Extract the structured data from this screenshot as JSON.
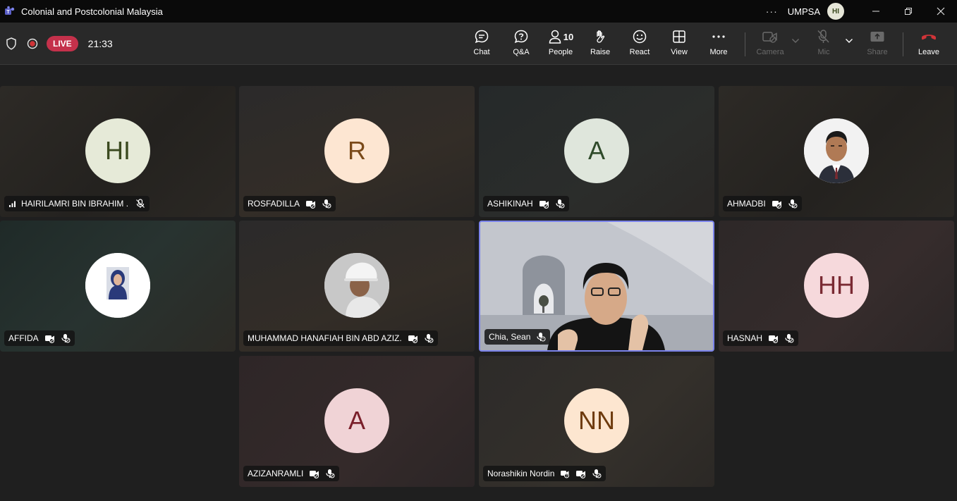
{
  "window": {
    "title": "Colonial and Postcolonial Malaysia",
    "more": "···",
    "org": "UMPSA",
    "user_initials": "HI"
  },
  "toolbar": {
    "live_label": "LIVE",
    "timer": "21:33",
    "chat": "Chat",
    "qa": "Q&A",
    "people": "People",
    "people_count": "10",
    "raise": "Raise",
    "react": "React",
    "view": "View",
    "more": "More",
    "camera": "Camera",
    "mic": "Mic",
    "share": "Share",
    "leave": "Leave"
  },
  "participants": [
    {
      "name": "HAIRILAMRI BIN IBRAHIM .",
      "initials": "HI",
      "avatar_bg": "#e6ead8",
      "avatar_fg": "#3b4a1f"
    },
    {
      "name": "ROSFADILLA",
      "initials": "R",
      "avatar_bg": "#fde6d2",
      "avatar_fg": "#7a4a1a"
    },
    {
      "name": "ASHIKINAH",
      "initials": "A",
      "avatar_bg": "#dfe6dc",
      "avatar_fg": "#2f4a2a"
    },
    {
      "name": "AHMADBI",
      "initials": "",
      "avatar_bg": "#f5f5f5"
    },
    {
      "name": "AFFIDA",
      "initials": "",
      "avatar_bg": "#ffffff"
    },
    {
      "name": "MUHAMMAD HANAFIAH BIN ABD AZIZ.",
      "initials": "",
      "avatar_bg": "#cfcfcf"
    },
    {
      "name": "Chia, Sean",
      "initials": ""
    },
    {
      "name": "HASNAH",
      "initials": "HH",
      "avatar_bg": "#f6d9dc",
      "avatar_fg": "#7a2a33"
    },
    {
      "name": "AZIZANRAMLI",
      "initials": "A",
      "avatar_bg": "#f0d3d6",
      "avatar_fg": "#7a1f2a"
    },
    {
      "name": "Norashikin Nordin",
      "initials": "NN",
      "avatar_bg": "#fde6d0",
      "avatar_fg": "#6e3b0e"
    }
  ]
}
